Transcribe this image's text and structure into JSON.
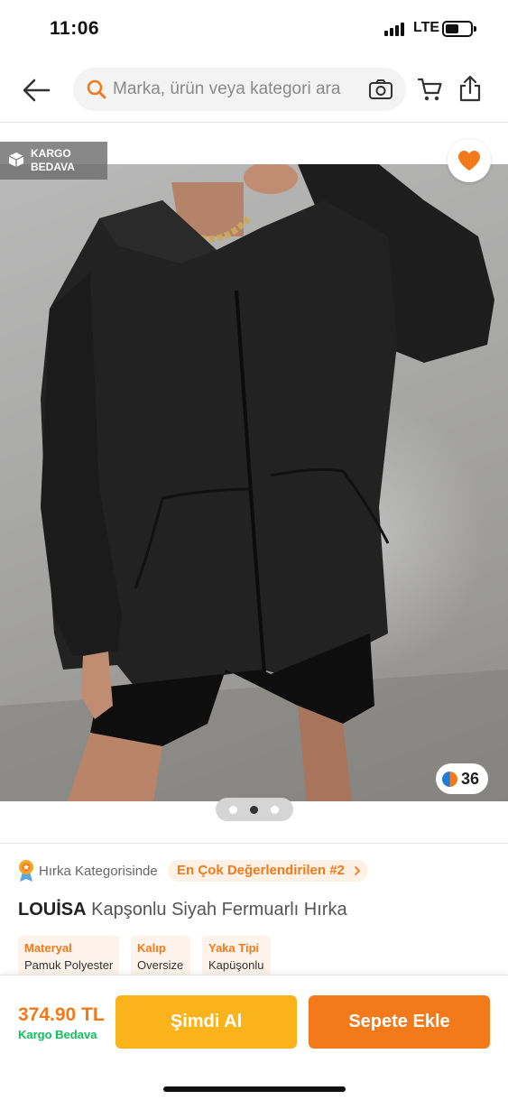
{
  "status_bar": {
    "time": "11:06",
    "network": "LTE"
  },
  "header": {
    "search_placeholder": "Marka, ürün veya kategori ara",
    "icons": [
      "back-arrow-icon",
      "search-icon",
      "camera-icon",
      "cart-icon",
      "share-icon"
    ]
  },
  "gallery": {
    "kargo_badge": "KARGO BEDAVA",
    "review_count": "36",
    "pages": 3,
    "active_page": 2,
    "favorite": true
  },
  "rank": {
    "label": "Hırka Kategorisinde",
    "pill": "En Çok Değerlendirilen #2"
  },
  "product": {
    "brand": "LOUİSA",
    "name": "Kapşonlu Siyah Fermuarlı Hırka",
    "attributes": [
      {
        "key": "Materyal",
        "value": "Pamuk Polyester"
      },
      {
        "key": "Kalıp",
        "value": "Oversize"
      },
      {
        "key": "Yaka Tipi",
        "value": "Kapüşonlu"
      }
    ]
  },
  "bottom_bar": {
    "price": "374.90 TL",
    "shipping": "Kargo Bedava",
    "buy_now_label": "Şimdi Al",
    "add_to_cart_label": "Sepete Ekle"
  },
  "colors": {
    "accent": "#f27a1a",
    "buy_now": "#fbb31b",
    "free_shipping": "#0bc15c"
  }
}
